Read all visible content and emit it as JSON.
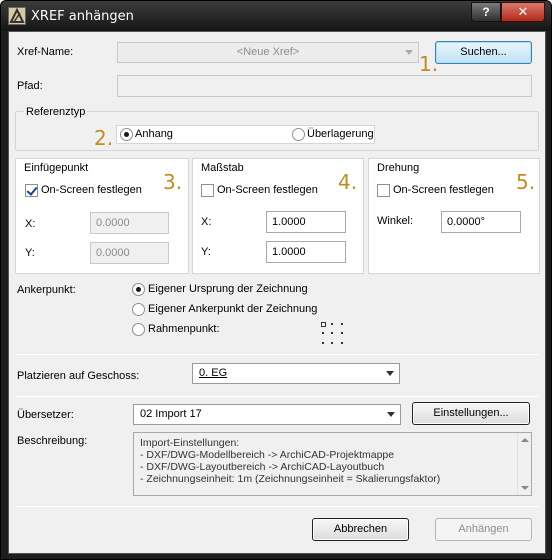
{
  "window": {
    "title": "XREF anhängen",
    "help_label": "?",
    "close_label": "✕"
  },
  "xref": {
    "name_label": "Xref-Name:",
    "name_value": "<Neue Xref>",
    "search_button": "Suchen...",
    "path_label": "Pfad:",
    "path_value": ""
  },
  "markers": {
    "m1": "1.",
    "m2": "2.",
    "m3": "3.",
    "m4": "4.",
    "m5": "5."
  },
  "reference_type": {
    "title": "Referenztyp",
    "attach_label": "Anhang",
    "overlay_label": "Überlagerung",
    "selected": "Anhang"
  },
  "insertion_point": {
    "title": "Einfügepunkt",
    "onscreen_label": "On-Screen festlegen",
    "onscreen_checked": true,
    "x_label": "X:",
    "x_value": "0.0000",
    "y_label": "Y:",
    "y_value": "0.0000"
  },
  "scale": {
    "title": "Maßstab",
    "onscreen_label": "On-Screen festlegen",
    "onscreen_checked": false,
    "x_label": "X:",
    "x_value": "1.0000",
    "y_label": "Y:",
    "y_value": "1.0000"
  },
  "rotation": {
    "title": "Drehung",
    "onscreen_label": "On-Screen festlegen",
    "onscreen_checked": false,
    "angle_label": "Winkel:",
    "angle_value": "0.0000°"
  },
  "anchor": {
    "label": "Ankerpunkt:",
    "options": [
      "Eigener Ursprung der Zeichnung",
      "Eigener Ankerpunkt der Zeichnung",
      "Rahmenpunkt:"
    ],
    "selected": "Eigener Ursprung der Zeichnung"
  },
  "story": {
    "label": "Platzieren auf Geschoss:",
    "value": "0. EG"
  },
  "translator": {
    "label": "Übersetzer:",
    "value": "02 Import 17",
    "settings_button": "Einstellungen..."
  },
  "description": {
    "label": "Beschreibung:",
    "lines": [
      "Import-Einstellungen:",
      "- DXF/DWG-Modellbereich -> ArchiCAD-Projektmappe",
      "- DXF/DWG-Layoutbereich -> ArchiCAD-Layoutbuch",
      "- Zeichnungseinheit: 1m (Zeichnungseinheit = Skalierungsfaktor)"
    ]
  },
  "footer": {
    "cancel_button": "Abbrechen",
    "attach_button": "Anhängen"
  },
  "colors": {
    "marker": "#c48c1f",
    "titlebar": "#1e1e1e",
    "close_button": "#c0392b"
  }
}
